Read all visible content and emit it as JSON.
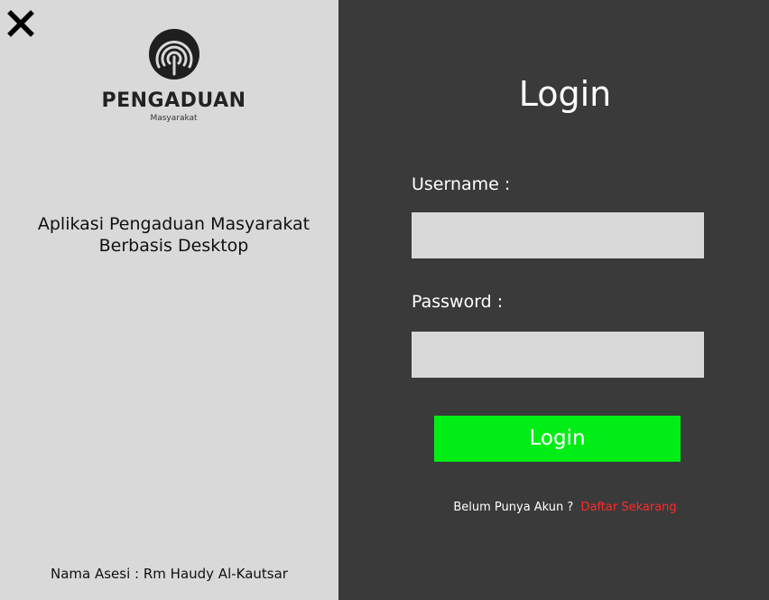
{
  "brand": {
    "title": "PENGADUAN",
    "subtitle": "Masyarakat"
  },
  "left": {
    "description_line1": "Aplikasi Pengaduan Masyarakat",
    "description_line2": "Berbasis Desktop",
    "footer": "Nama Asesi : Rm Haudy Al-Kautsar"
  },
  "login": {
    "title": "Login",
    "username_label": "Username :",
    "username_value": "",
    "password_label": "Password :",
    "password_value": "",
    "button_label": "Login",
    "register_prompt": "Belum Punya Akun ?",
    "register_link": "Daftar Sekarang"
  },
  "icons": {
    "close": "close-icon",
    "logo": "fingerprint-logo-icon"
  },
  "colors": {
    "left_background": "#d9d9d9",
    "right_background": "#3a3a3a",
    "input_background": "#d9d9d9",
    "login_button": "#00ee16",
    "register_link": "#ff2a2a",
    "text_light": "#ffffff",
    "text_dark": "#111111"
  }
}
